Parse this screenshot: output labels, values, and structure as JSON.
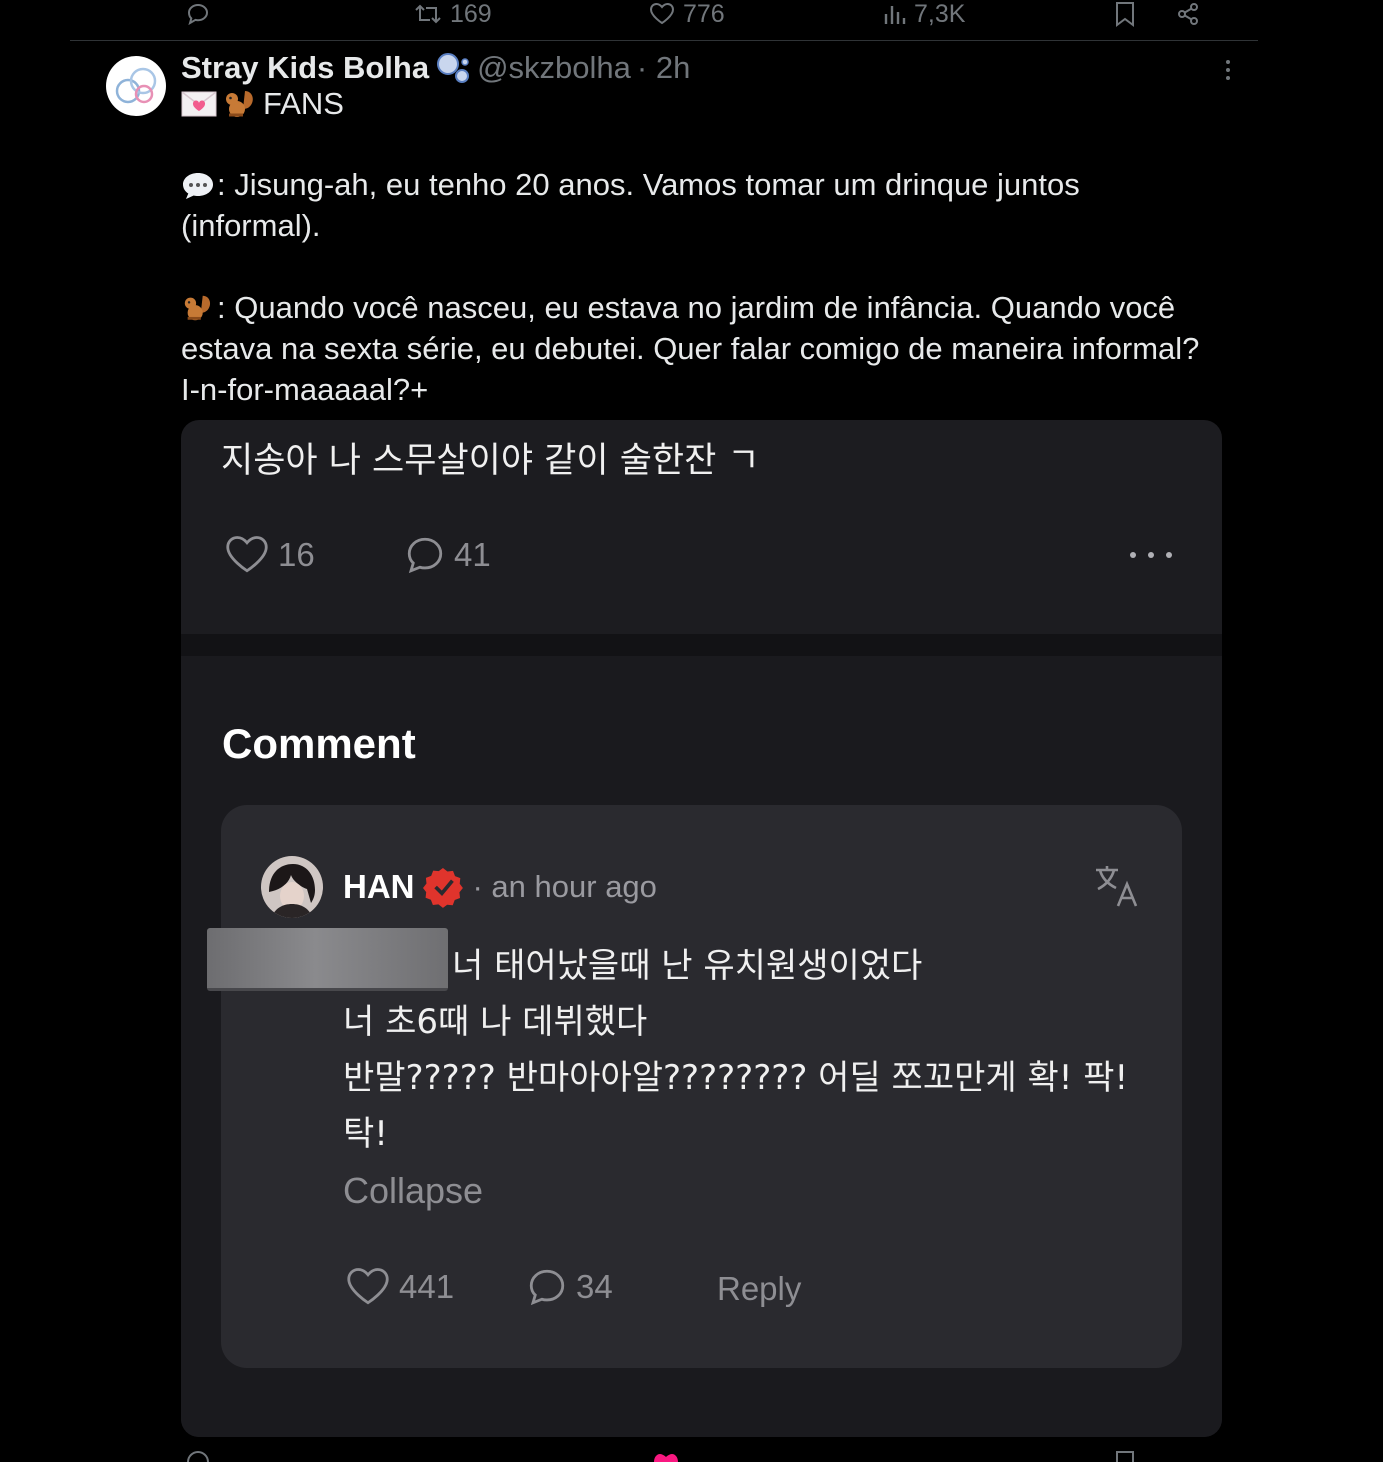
{
  "top_actions": {
    "retweets": "169",
    "likes": "776",
    "views": "7,3K"
  },
  "tweet": {
    "author_name": "Stray Kids Bolha",
    "handle": "@skzbolha",
    "time": "· 2h",
    "tag_line": "FANS",
    "fan_line_1": ": Jisung-ah, eu tenho 20 anos. Vamos tomar um drinque juntos",
    "fan_line_2": "(informal).",
    "han_line_1": ": Quando você nasceu, eu estava no jardim de infância. Quando você",
    "han_line_2": "estava na sexta série, eu debutei. Quer falar comigo de maneira informal?",
    "han_line_3": "I-n-for-maaaaal?+"
  },
  "embedded": {
    "post_text": "지송아 나 스무살이야 같이 술한잔 ㄱ",
    "post_likes": "16",
    "post_comments": "41",
    "comment_heading": "Comment",
    "comment": {
      "author": "HAN",
      "time": "· an hour ago",
      "line_1": "너 태어났을때 난 유치원생이었다",
      "line_2": "너 초6때 나 데뷔했다",
      "line_3": "반말????? 반마아아알???????? 어딜 쪼꼬만게 확! 팍!",
      "line_4": "탁!",
      "collapse_label": "Collapse",
      "likes": "441",
      "replies": "34",
      "reply_label": "Reply"
    }
  },
  "colors": {
    "background": "#000000",
    "muted": "#71767b",
    "verified_badge": "#e0342c",
    "like_pink": "#f91880"
  },
  "icons": [
    "reply-icon",
    "retweet-icon",
    "like-icon",
    "views-icon",
    "bookmark-icon",
    "share-icon",
    "more-icon",
    "bubbles-emoji",
    "love-letter-emoji",
    "squirrel-emoji",
    "speech-bubble-emoji",
    "verified-badge-icon",
    "translate-icon"
  ]
}
